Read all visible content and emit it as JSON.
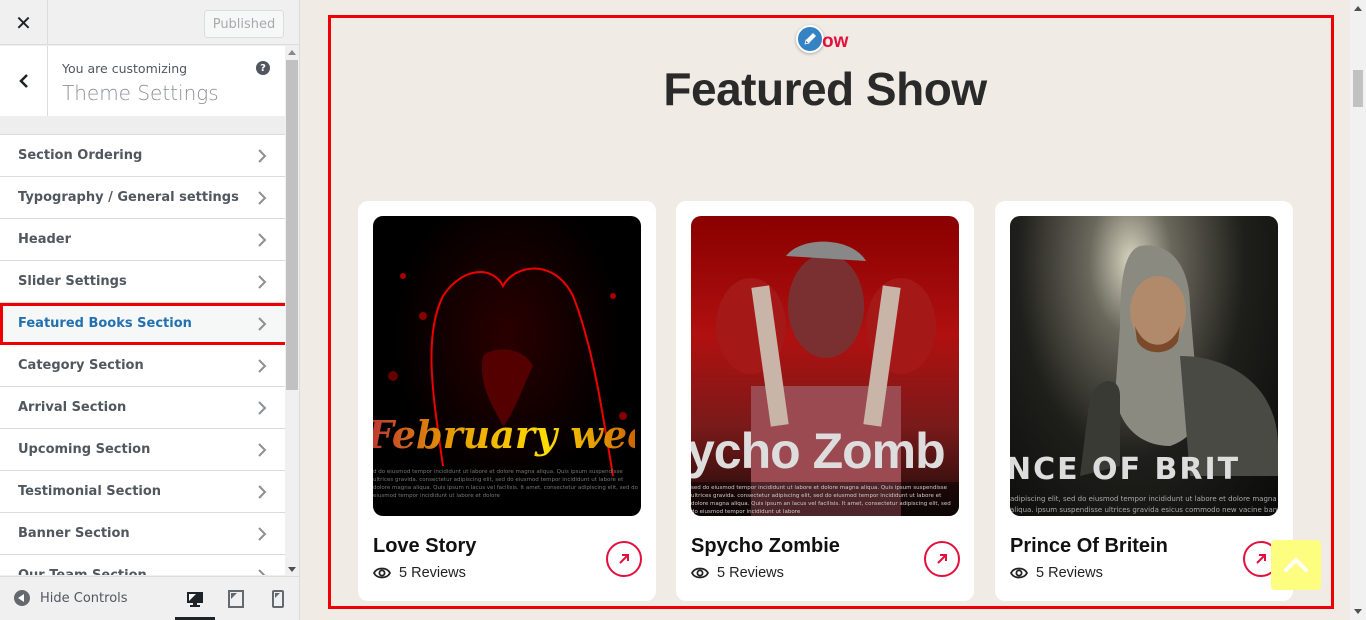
{
  "sidebar": {
    "close_label": "✕",
    "publish_button": "Published",
    "customizing_label": "You are customizing",
    "customizing_title": "Theme Settings",
    "help_label": "?",
    "menu_items": [
      {
        "label": "Section Ordering"
      },
      {
        "label": "Typography / General settings"
      },
      {
        "label": "Header"
      },
      {
        "label": "Slider Settings"
      },
      {
        "label": "Featured Books Section",
        "active": true
      },
      {
        "label": "Category Section"
      },
      {
        "label": "Arrival Section"
      },
      {
        "label": "Upcoming Section"
      },
      {
        "label": "Testimonial Section"
      },
      {
        "label": "Banner Section"
      },
      {
        "label": "Our Team Section"
      }
    ],
    "footer": {
      "hide_controls": "Hide Controls",
      "devices": [
        "desktop",
        "tablet",
        "mobile"
      ],
      "active_device": "desktop"
    }
  },
  "preview": {
    "subtitle": "ow",
    "title": "Featured Show",
    "accent_color": "#e3103d",
    "cards": [
      {
        "title": "Love Story",
        "reviews": "5 Reviews",
        "poster_text": "February week",
        "poster_lorem": "d do eiusmod tempor incididunt ut labore et dolore magna aliqua. Quis ipsum suspendisse ultrices gravida. consectetur adipiscing elit, sed do eiusmod tempor incididunt ut labore et dolore magna aliqua. Quis ipsum n lacus vel facilisis. It amet, consectetur adipiscing elit, sed do eiusmod tempor incididunt ut labore et dolore"
      },
      {
        "title": "Spycho Zombie",
        "reviews": "5 Reviews",
        "poster_text": "ycho Zomb",
        "poster_lorem": "sed do eiusmod tempor incididunt ut labore et dolore magna aliqua. Quis ipsum suspendisse ultrices gravida. consectetur adipiscing elit, sed do eiusmod tempor incididunt ut labore et dolore magna aliqua. Quis ipsum an lacus vel facilisis. It amet, consectetur adipiscing elit, sed do eiusmod tempor incididunt ut labore"
      },
      {
        "title": "Prince Of Britein",
        "reviews": "5 Reviews",
        "poster_text": "NCE OF BRIT",
        "poster_lorem": "adipiscing elit, sed do eiusmod tempor incididunt ut labore et dolore magna aliqua. ipsum suspendisse ultrices gravida esicus commodo new vacine ban"
      }
    ]
  }
}
